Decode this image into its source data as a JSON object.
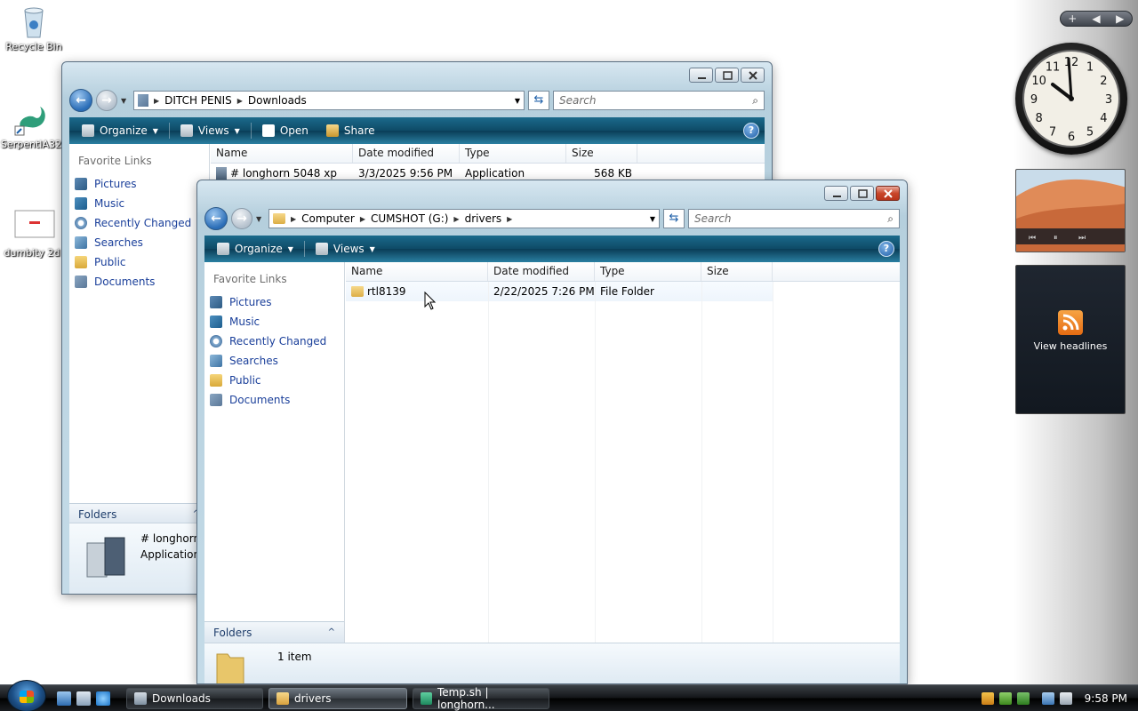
{
  "desktop": {
    "icons": [
      {
        "label": "Recycle Bin"
      },
      {
        "label": "SerpentIA32"
      },
      {
        "label": "dumbity 2d"
      }
    ]
  },
  "sidebar": {
    "controls": [
      "+",
      "◀",
      "▶"
    ],
    "feed_label": "View headlines",
    "clock_numbers": [
      "12",
      "1",
      "2",
      "3",
      "4",
      "5",
      "6",
      "7",
      "8",
      "9",
      "10",
      "11"
    ]
  },
  "downloads_window": {
    "title": "Downloads",
    "address": [
      "DITCH PENIS",
      "Downloads"
    ],
    "search_placeholder": "Search",
    "toolbar": {
      "organize": "Organize",
      "views": "Views",
      "open": "Open",
      "share": "Share",
      "help": "?"
    },
    "favorite_links_title": "Favorite Links",
    "links": [
      "Pictures",
      "Music",
      "Recently Changed",
      "Searches",
      "Public",
      "Documents"
    ],
    "columns": [
      "Name",
      "Date modified",
      "Type",
      "Size"
    ],
    "rows": [
      {
        "name": "# longhorn 5048 xp",
        "date": "3/3/2025 9:56 PM",
        "type": "Application",
        "size": "568 KB"
      }
    ],
    "folders_label": "Folders",
    "details": {
      "name": "# longhorn",
      "type": "Application"
    }
  },
  "drivers_window": {
    "title": "drivers",
    "address": [
      "Computer",
      "CUMSHOT (G:)",
      "drivers"
    ],
    "search_placeholder": "Search",
    "toolbar": {
      "organize": "Organize",
      "views": "Views",
      "help": "?"
    },
    "favorite_links_title": "Favorite Links",
    "links": [
      "Pictures",
      "Music",
      "Recently Changed",
      "Searches",
      "Public",
      "Documents"
    ],
    "columns": [
      "Name",
      "Date modified",
      "Type",
      "Size"
    ],
    "rows": [
      {
        "name": "rtl8139",
        "date": "2/22/2025 7:26 PM",
        "type": "File Folder",
        "size": ""
      }
    ],
    "folders_label": "Folders",
    "details": {
      "count": "1 item"
    }
  },
  "taskbar": {
    "tasks": [
      {
        "label": "Downloads",
        "active": false
      },
      {
        "label": "drivers",
        "active": true
      },
      {
        "label": "Temp.sh | longhorn...",
        "active": false
      }
    ],
    "time": "9:58 PM"
  },
  "colors": {
    "command_bar": "#0e4a66",
    "link_blue": "#1a3f9a",
    "close_red": "#c9462a"
  }
}
